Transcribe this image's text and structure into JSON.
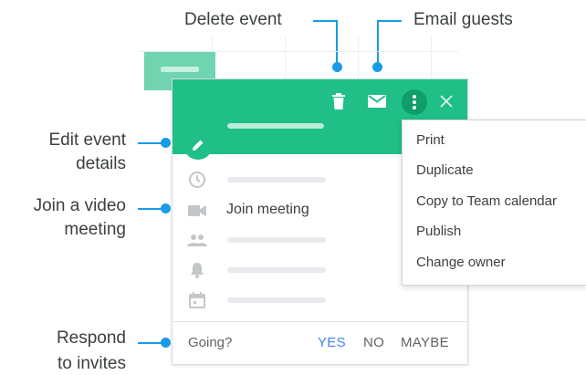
{
  "callouts": {
    "delete_event": "Delete event",
    "email_guests": "Email guests",
    "edit_event_line1": "Edit event",
    "edit_event_line2": "details",
    "join_video_line1": "Join a video",
    "join_video_line2": "meeting",
    "respond_line1": "Respond",
    "respond_line2": "to invites"
  },
  "event_card": {
    "join_meeting_label": "Join meeting",
    "going_label": "Going?",
    "rsvp_yes": "YES",
    "rsvp_no": "NO",
    "rsvp_maybe": "MAYBE"
  },
  "menu": {
    "items": [
      "Print",
      "Duplicate",
      "Copy to Team calendar",
      "Publish",
      "Change owner"
    ]
  },
  "icons": {
    "delete": "trash-icon",
    "email": "mail-icon",
    "more": "more-vert-icon",
    "close": "close-icon",
    "edit": "pencil-icon",
    "time": "clock-icon",
    "video": "video-icon",
    "guests": "people-icon",
    "notification": "bell-icon",
    "calendar": "calendar-icon"
  },
  "colors": {
    "header": "#1fbf87",
    "accent_blue": "#1a9be6",
    "rsvp_yes": "#4285f4"
  }
}
